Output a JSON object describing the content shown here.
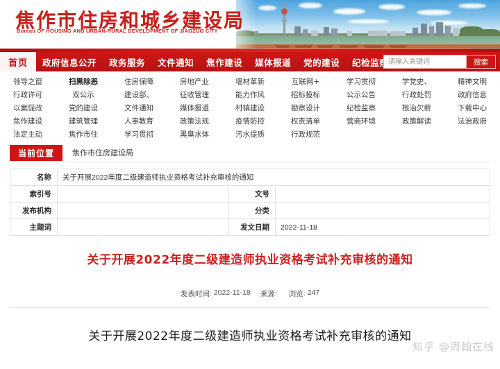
{
  "site": {
    "title_cn": "焦作市住房和城乡建设局",
    "title_en": "Bureau OF HOUSING AND URBAN-RURAL DEVELOPMENT OF JIAOZUO CITY"
  },
  "nav": {
    "home_label": "首页",
    "items": [
      {
        "label": "政府信息公开"
      },
      {
        "label": "政务服务"
      },
      {
        "label": "文件通知"
      },
      {
        "label": "焦作建设"
      },
      {
        "label": "媒体报道"
      },
      {
        "label": "党的建设"
      },
      {
        "label": "纪检监察"
      }
    ],
    "search": {
      "placeholder": "请输入关键词",
      "value": "",
      "button_label": "搜索"
    }
  },
  "megamenu": {
    "columns": [
      {
        "items": [
          {
            "label": "领导之窗",
            "strong": false
          },
          {
            "label": "行政许可",
            "strong": false
          },
          {
            "label": "以案促改",
            "strong": false
          },
          {
            "label": "焦作建设",
            "strong": false
          },
          {
            "label": "法定主动",
            "strong": false
          }
        ]
      },
      {
        "items": [
          {
            "label": "扫黑除恶",
            "strong": true
          },
          {
            "label": "双公示",
            "strong": false
          },
          {
            "label": "党的建设",
            "strong": false
          },
          {
            "label": "建筑管理",
            "strong": false
          },
          {
            "label": "焦作市住",
            "strong": false
          }
        ]
      },
      {
        "items": [
          {
            "label": "住房保障",
            "strong": false
          },
          {
            "label": "建设部、",
            "strong": false
          },
          {
            "label": "文件通知",
            "strong": false
          },
          {
            "label": "人事教育",
            "strong": false
          },
          {
            "label": "学习贯彻",
            "strong": false
          }
        ]
      },
      {
        "items": [
          {
            "label": "房地产业",
            "strong": false
          },
          {
            "label": "征收管理",
            "strong": false
          },
          {
            "label": "媒体报道",
            "strong": false
          },
          {
            "label": "政策法规",
            "strong": false
          },
          {
            "label": "黑臭水体",
            "strong": false
          }
        ]
      },
      {
        "items": [
          {
            "label": "墙材革新",
            "strong": false
          },
          {
            "label": "能力作风",
            "strong": false
          },
          {
            "label": "村镇建设",
            "strong": false
          },
          {
            "label": "疫情防控",
            "strong": false
          },
          {
            "label": "污水提质",
            "strong": false
          }
        ]
      },
      {
        "items": [
          {
            "label": "互联网+",
            "strong": false
          },
          {
            "label": "招标投标",
            "strong": false
          },
          {
            "label": "勘察设计",
            "strong": false
          },
          {
            "label": "权责清单",
            "strong": false
          },
          {
            "label": "行政规范",
            "strong": false
          }
        ]
      },
      {
        "items": [
          {
            "label": "学习贯彻",
            "strong": false
          },
          {
            "label": "公示公告",
            "strong": false
          },
          {
            "label": "纪检监察",
            "strong": false
          },
          {
            "label": "营商环境",
            "strong": false
          }
        ]
      },
      {
        "items": [
          {
            "label": "学党史、",
            "strong": false
          },
          {
            "label": "行政处罚",
            "strong": false
          },
          {
            "label": "根治欠薪",
            "strong": false
          },
          {
            "label": "政策解读",
            "strong": false
          }
        ]
      },
      {
        "items": [
          {
            "label": "精神文明",
            "strong": false
          },
          {
            "label": "政府信息",
            "strong": false
          },
          {
            "label": "下载中心",
            "strong": false
          },
          {
            "label": "法治政府",
            "strong": false
          }
        ]
      }
    ]
  },
  "breadcrumb": {
    "tag": "当前位置",
    "path": "焦作市住房建设局"
  },
  "info_table": {
    "rows": [
      {
        "label1": "名称",
        "value1": "关于开展2022年度二级建造师执业资格考试补充审核的通知",
        "label2": "",
        "value2": "",
        "full": true
      },
      {
        "label1": "索引号",
        "value1": "",
        "label2": "文号",
        "value2": "",
        "full": false
      },
      {
        "label1": "发布机构",
        "value1": "",
        "label2": "分类",
        "value2": "",
        "full": false
      },
      {
        "label1": "主题词",
        "value1": "",
        "label2": "发文日期",
        "value2": "2022-11-18",
        "full": false
      }
    ]
  },
  "article": {
    "title": "关于开展2022年度二级建造师执业资格考试补充审核的通知",
    "meta": {
      "publish_label": "发表时间:",
      "publish_value": "2022-11-18",
      "source_label": "来源:",
      "source_value": "",
      "views_label": "浏览:",
      "views_value": "247"
    },
    "body_title": "关于开展2022年度二级建造师执业资格考试补充审核的通知"
  },
  "watermark": {
    "text": "知乎 @周翰在线"
  },
  "colors": {
    "brand_red": "#cf1616",
    "title_red": "#c81e1e",
    "article_red": "#cc2222",
    "border_gray": "#dfe3e6"
  }
}
